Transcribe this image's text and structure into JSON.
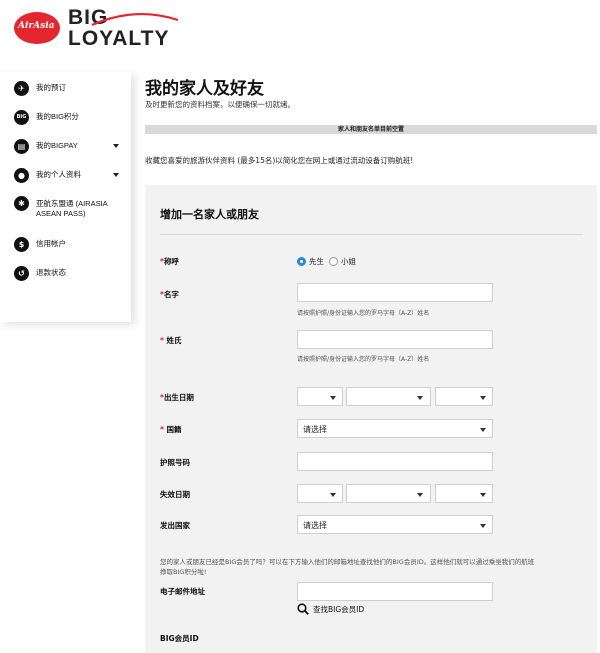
{
  "brand": {
    "logo_text": "AirAsia",
    "line1": "BIG",
    "line2": "LOYALTY",
    "accent_color": "#e4262f"
  },
  "sidebar": {
    "items": [
      {
        "label": "我的预订",
        "icon": "airplane-icon",
        "icon_text": "✈",
        "has_caret": false
      },
      {
        "label": "我的BIG积分",
        "icon": "big-points-icon",
        "icon_text": "BIG",
        "has_caret": false
      },
      {
        "label": "我的BIGPAY",
        "icon": "card-icon",
        "icon_text": "▤",
        "has_caret": true
      },
      {
        "label": "我的个人资料",
        "icon": "profile-icon",
        "icon_text": "●",
        "has_caret": true
      },
      {
        "label": "亚航东盟通 (AIRASIA ASEAN PASS)",
        "icon": "asean-pass-icon",
        "icon_text": "✱",
        "has_caret": false
      },
      {
        "label": "信用帐户",
        "icon": "credit-icon",
        "icon_text": "$",
        "has_caret": false
      },
      {
        "label": "退款状态",
        "icon": "refund-icon",
        "icon_text": "↺",
        "has_caret": false
      }
    ]
  },
  "main": {
    "title": "我的家人及好友",
    "subtitle": "及时更新您的资料档案，以便确保一切就绪。",
    "empty_notice": "家人和朋友名单目前空置",
    "intro": "收藏您喜爱的旅游伙伴资料 (最多15名)以简化您在网上或通过流动设备订购航班!"
  },
  "form": {
    "title": "增加一名家人或朋友",
    "salutation": {
      "label": "称呼",
      "options": [
        {
          "label": "先生",
          "selected": true
        },
        {
          "label": "小姐",
          "selected": false
        }
      ]
    },
    "given_name": {
      "label": "名字",
      "value": "",
      "hint": "请按照护照/身份证输入您的罗马字母（A-Z）姓名"
    },
    "family_name": {
      "label": "姓氏",
      "value": "",
      "hint": "请按照护照/身份证输入您的罗马字母（A-Z）姓名"
    },
    "dob": {
      "label": "出生日期",
      "day": "",
      "month": "",
      "year": ""
    },
    "nationality": {
      "label": "国籍",
      "value": "请选择"
    },
    "passport": {
      "label": "护照号码",
      "value": ""
    },
    "expiry": {
      "label": "失效日期",
      "day": "",
      "month": "",
      "year": ""
    },
    "issuing_country": {
      "label": "发出国家",
      "value": "请选择"
    },
    "member_note": "您的家人或朋友已经是BIG会员了吗？可以在下方输入他们的邮箱地址查找他们的BIG会员ID。这样他们就可以通过乘坐我们的航班挣取BIG积分啦!",
    "email": {
      "label": "电子邮件地址",
      "value": ""
    },
    "search_link": "查找BIG会员ID",
    "big_id_label": "BIG会员ID"
  }
}
